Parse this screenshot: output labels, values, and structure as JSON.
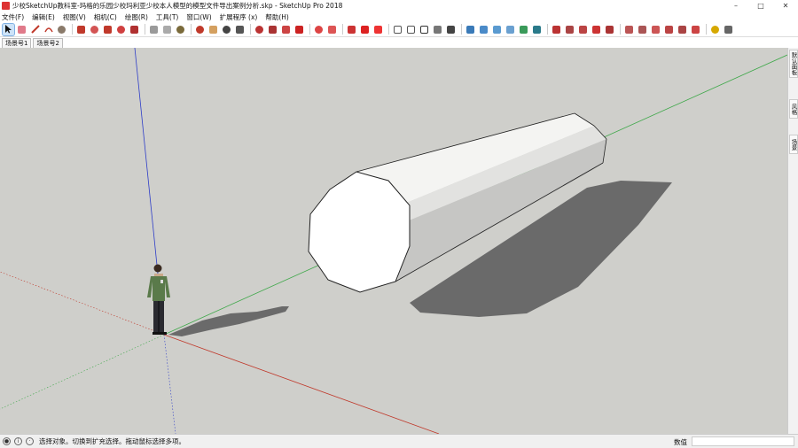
{
  "window": {
    "title": "少校SketchUp教科室-玛格的乐园少校玛利亚少校本人模型的模型文件导出案例分析.skp - SketchUp Pro 2018",
    "controls": [
      "–",
      "□",
      "✕"
    ]
  },
  "menu": [
    "文件(F)",
    "编辑(E)",
    "视图(V)",
    "相机(C)",
    "绘图(R)",
    "工具(T)",
    "窗口(W)",
    "扩展程序 (x)",
    "帮助(H)"
  ],
  "scenes": [
    "场景号1",
    "场景号2"
  ],
  "right_tray_tabs": [
    "默认面板",
    "风格",
    "场景"
  ],
  "status": {
    "hint": "选择对象。切换到扩充选择。拖动鼠标选择多项。",
    "measure_label": "数值",
    "measure_value": ""
  },
  "colors": {
    "background": "#cfcfcb",
    "axis_red": "#c0392b",
    "axis_green": "#3fa84a",
    "axis_blue": "#2e3dc8",
    "shadow": "#6a6a6a"
  }
}
